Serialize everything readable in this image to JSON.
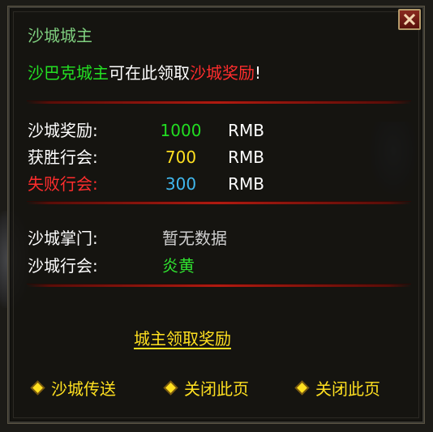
{
  "dialog": {
    "title": "沙城城主",
    "notice_part1": "沙巴克城主",
    "notice_part2": "可在此领取",
    "notice_part3": "沙城奖励",
    "notice_part4": "!"
  },
  "rewards": [
    {
      "label": "沙城奖励:",
      "value": "1000",
      "unit": "RMB"
    },
    {
      "label": "获胜行会:",
      "value": "700",
      "unit": "RMB"
    },
    {
      "label": "失败行会:",
      "value": "300",
      "unit": "RMB"
    }
  ],
  "info": [
    {
      "label": "沙城掌门:",
      "value": "暂无数据"
    },
    {
      "label": "沙城行会:",
      "value": "炎黄"
    }
  ],
  "claim_label": "城主领取奖励",
  "footer": [
    {
      "label": "沙城传送"
    },
    {
      "label": "关闭此页"
    },
    {
      "label": "关闭此页"
    }
  ],
  "colors": {
    "title": "#7fd07f",
    "highlight_green": "#23e023",
    "highlight_red": "#ff2d2d",
    "gold": "#ffe020",
    "blue": "#40b8ee"
  },
  "icons": {
    "close": "close-icon",
    "footer_bullet": "diamond-bullet-icon"
  }
}
